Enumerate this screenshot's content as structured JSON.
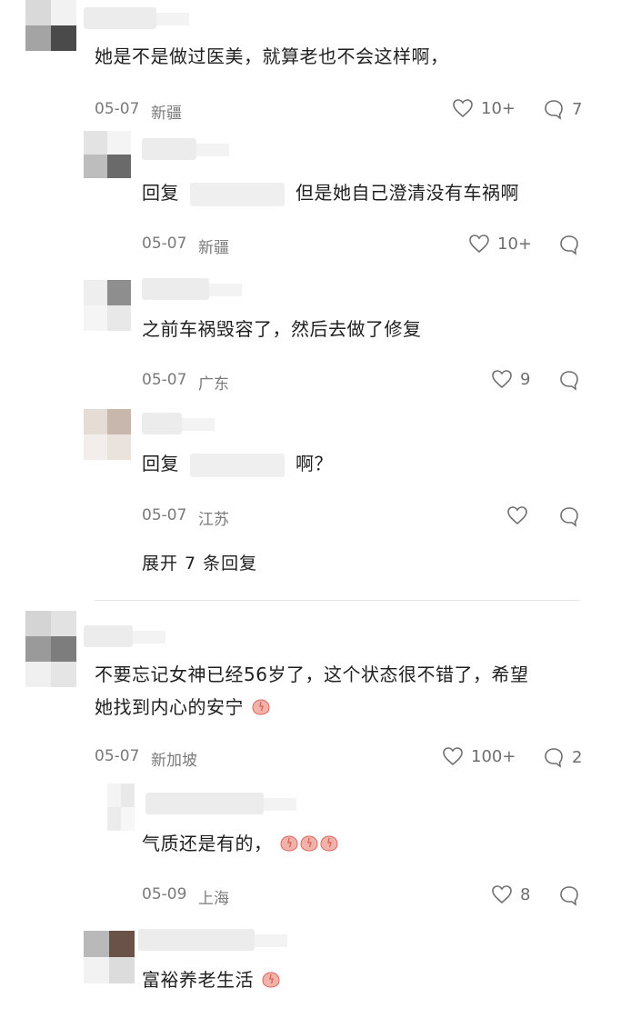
{
  "comments": [
    {
      "text": "她是不是做过医美，就算老也不会这样啊，",
      "date": "05-07",
      "location": "新疆",
      "likes": "10+",
      "replies": "7"
    },
    {
      "reply_prefix": "回复",
      "text": "但是她自己澄清没有车祸啊",
      "date": "05-07",
      "location": "新疆",
      "likes": "10+"
    },
    {
      "text": "之前车祸毁容了，然后去做了修复",
      "date": "05-07",
      "location": "广东",
      "likes": "9"
    },
    {
      "reply_prefix": "回复",
      "text": "啊？",
      "date": "05-07",
      "location": "江苏",
      "likes": ""
    },
    {
      "expand_label": "展开 7 条回复"
    },
    {
      "text_line1": "不要忘记女神已经56岁了，这个状态很不错了，希望",
      "text_line2": "她找到内心的安宁",
      "date": "05-07",
      "location": "新加坡",
      "likes": "100+",
      "replies": "2"
    },
    {
      "text": "气质还是有的，",
      "date": "05-09",
      "location": "上海",
      "likes": "8"
    },
    {
      "text": "富裕养老生活"
    }
  ],
  "icons": {
    "like": "heart-outline-icon",
    "reply": "speech-bubble-icon",
    "emoji": "blushing-face-emoji"
  },
  "colors": {
    "text": "#1f1f1f",
    "meta": "#7a7a7a",
    "divider": "#e6e6e6",
    "emoji": "#e0675e"
  }
}
